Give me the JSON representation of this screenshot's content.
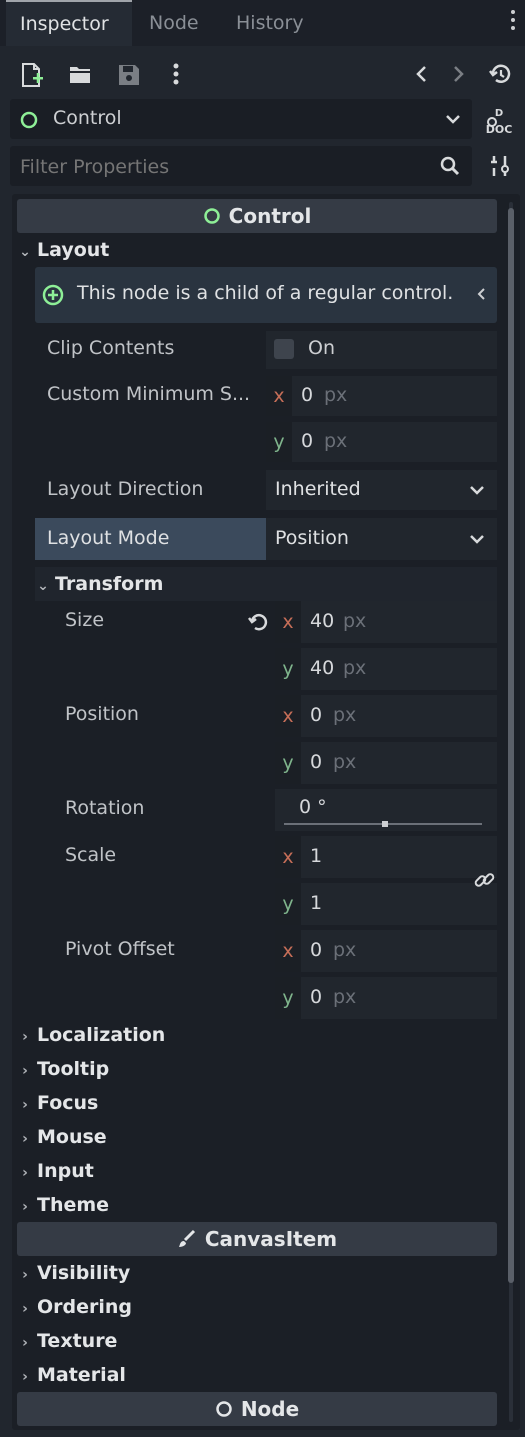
{
  "tabs": [
    {
      "label": "Inspector"
    },
    {
      "label": "Node"
    },
    {
      "label": "History"
    }
  ],
  "node_selector": {
    "label": "Control"
  },
  "filter": {
    "placeholder": "Filter Properties"
  },
  "sections": {
    "control": "Control",
    "canvasitem": "CanvasItem",
    "node": "Node"
  },
  "layout": {
    "group_label": "Layout",
    "info_text": "This node is a child of a regular control.",
    "clip_contents": {
      "label": "Clip Contents",
      "value": "On",
      "checked": false
    },
    "custom_min_size": {
      "label": "Custom Minimum S...",
      "x": "0",
      "y": "0",
      "unit": "px"
    },
    "layout_direction": {
      "label": "Layout Direction",
      "value": "Inherited"
    },
    "layout_mode": {
      "label": "Layout Mode",
      "value": "Position"
    }
  },
  "transform": {
    "group_label": "Transform",
    "size": {
      "label": "Size",
      "x": "40",
      "y": "40",
      "unit": "px"
    },
    "position": {
      "label": "Position",
      "x": "0",
      "y": "0",
      "unit": "px"
    },
    "rotation": {
      "label": "Rotation",
      "value": "0 °"
    },
    "scale": {
      "label": "Scale",
      "x": "1",
      "y": "1"
    },
    "pivot_offset": {
      "label": "Pivot Offset",
      "x": "0",
      "y": "0",
      "unit": "px"
    }
  },
  "axis_labels": {
    "x": "x",
    "y": "y"
  },
  "control_groups": [
    "Localization",
    "Tooltip",
    "Focus",
    "Mouse",
    "Input",
    "Theme"
  ],
  "canvasitem_groups": [
    "Visibility",
    "Ordering",
    "Texture",
    "Material"
  ],
  "colors": {
    "accent_green": "#8eef97",
    "axis_x": "#c66e58",
    "axis_y": "#7fb48c",
    "selected_row": "#3b4a5c"
  }
}
